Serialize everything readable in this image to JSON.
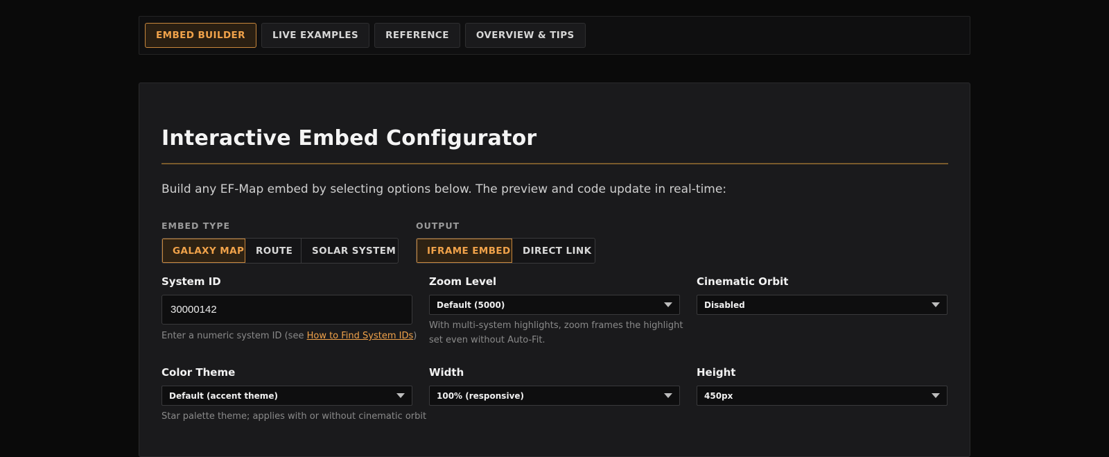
{
  "tabs": [
    {
      "label": "EMBED BUILDER",
      "active": true
    },
    {
      "label": "LIVE EXAMPLES",
      "active": false
    },
    {
      "label": "REFERENCE",
      "active": false
    },
    {
      "label": "OVERVIEW & TIPS",
      "active": false
    }
  ],
  "configurator": {
    "title": "Interactive Embed Configurator",
    "intro": "Build any EF-Map embed by selecting options below. The preview and code update in real-time:",
    "embed_type": {
      "label": "EMBED TYPE",
      "options": [
        "GALAXY MAP",
        "ROUTE",
        "SOLAR SYSTEM"
      ],
      "selected": "GALAXY MAP"
    },
    "output": {
      "label": "OUTPUT",
      "options": [
        "IFRAME EMBED",
        "DIRECT LINK"
      ],
      "selected": "IFRAME EMBED"
    },
    "system_id": {
      "label": "System ID",
      "value": "30000142",
      "help_prefix": "Enter a numeric system ID (see ",
      "help_link": "How to Find System IDs",
      "help_suffix": ")"
    },
    "zoom_level": {
      "label": "Zoom Level",
      "value": "Default (5000)",
      "help_line1": "With multi-system highlights, zoom frames the highlight",
      "help_line2": "set even without Auto-Fit."
    },
    "cinematic_orbit": {
      "label": "Cinematic Orbit",
      "value": "Disabled"
    },
    "color_theme": {
      "label": "Color Theme",
      "value": "Default (accent theme)",
      "help": "Star palette theme; applies with or without cinematic orbit"
    },
    "width": {
      "label": "Width",
      "value": "100% (responsive)"
    },
    "height": {
      "label": "Height",
      "value": "450px"
    }
  },
  "colors": {
    "accent": "#f0a24a",
    "background": "#0a0a0a",
    "panel": "#1a1a1c"
  }
}
